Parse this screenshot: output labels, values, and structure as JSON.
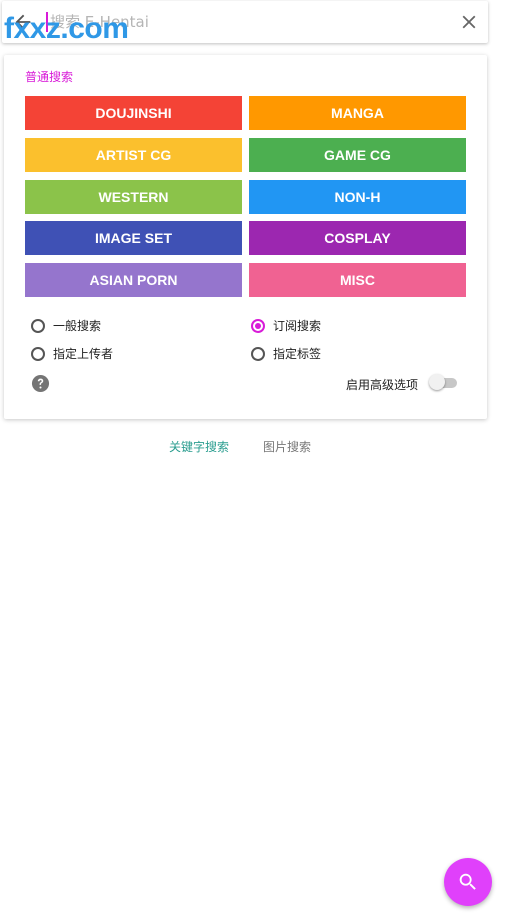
{
  "searchbar": {
    "placeholder": "搜索 E-Hentai",
    "value": ""
  },
  "watermark": "fxxz.com",
  "normal_search": {
    "title": "普通搜索",
    "categories": [
      {
        "label": "DOUJINSHI",
        "color": "#f44336"
      },
      {
        "label": "MANGA",
        "color": "#ff9800"
      },
      {
        "label": "ARTIST CG",
        "color": "#fbc02d"
      },
      {
        "label": "GAME CG",
        "color": "#4caf50"
      },
      {
        "label": "WESTERN",
        "color": "#8bc34a"
      },
      {
        "label": "NON-H",
        "color": "#2196f3"
      },
      {
        "label": "IMAGE SET",
        "color": "#3f51b5"
      },
      {
        "label": "COSPLAY",
        "color": "#9c27b0"
      },
      {
        "label": "ASIAN PORN",
        "color": "#9575cd"
      },
      {
        "label": "MISC",
        "color": "#f06292"
      }
    ],
    "modes": [
      {
        "label": "一般搜索",
        "checked": false
      },
      {
        "label": "订阅搜索",
        "checked": true
      },
      {
        "label": "指定上传者",
        "checked": false
      },
      {
        "label": "指定标签",
        "checked": false
      }
    ],
    "advanced_label": "启用高级选项",
    "advanced_enabled": false
  },
  "tabs": [
    {
      "label": "关键字搜索",
      "active": true
    },
    {
      "label": "图片搜索",
      "active": false
    }
  ],
  "colors": {
    "accent": "#d81bd8",
    "fab": "#e040fb",
    "active_tab": "#2a9d8f"
  },
  "icons": {
    "back": "arrow-left-icon",
    "close": "close-icon",
    "help": "help-circle-icon",
    "fab": "search-icon"
  }
}
